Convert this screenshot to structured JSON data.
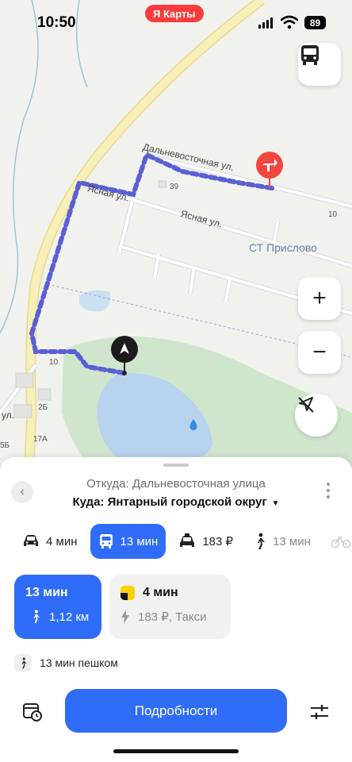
{
  "status_bar": {
    "time": "10:50",
    "app_badge": "Я Карты",
    "battery": "89"
  },
  "map": {
    "labels": {
      "street_dalnevostochnaya": "Дальневосточная ул.",
      "street_yasnaya_top": "Ясная ул.",
      "street_yasnaya_mid": "Ясная ул.",
      "street_ul_left": "ул.",
      "house_39": "39",
      "house_10_right": "10",
      "house_10_left": "10",
      "house_2b": "2Б",
      "house_17a": "17А",
      "house_5b": "5Б",
      "place_st_prislovo": "СТ Прислово"
    },
    "controls": {
      "zoom_in": "+",
      "zoom_out": "−"
    },
    "colors": {
      "route": "#5a5fd6",
      "destination_pin": "#f2473f",
      "water": "#b7d3ee",
      "forest": "#cfe6cd",
      "main_road": "#f7ecb1"
    }
  },
  "route_panel": {
    "from_text": "Откуда: Дальневосточная улица",
    "to_text": "Куда: Янтарный городской округ",
    "modes": [
      {
        "icon": "car-icon",
        "label": "4 мин"
      },
      {
        "icon": "bus-icon",
        "label": "13 мин",
        "active": true
      },
      {
        "icon": "taxi-icon",
        "label": "183 ₽"
      },
      {
        "icon": "walk-icon",
        "label": "13 мин"
      },
      {
        "icon": "bike-icon",
        "label": ""
      }
    ],
    "cards": {
      "transit": {
        "title": "13 мин",
        "walk_distance": "1,12 км"
      },
      "taxi": {
        "title": "4 мин",
        "price": "183 ₽, Такси"
      }
    },
    "walk_summary": "13 мин пешком",
    "details_button": "Подробности"
  },
  "theme": {
    "accent": "#2f6cf7"
  }
}
